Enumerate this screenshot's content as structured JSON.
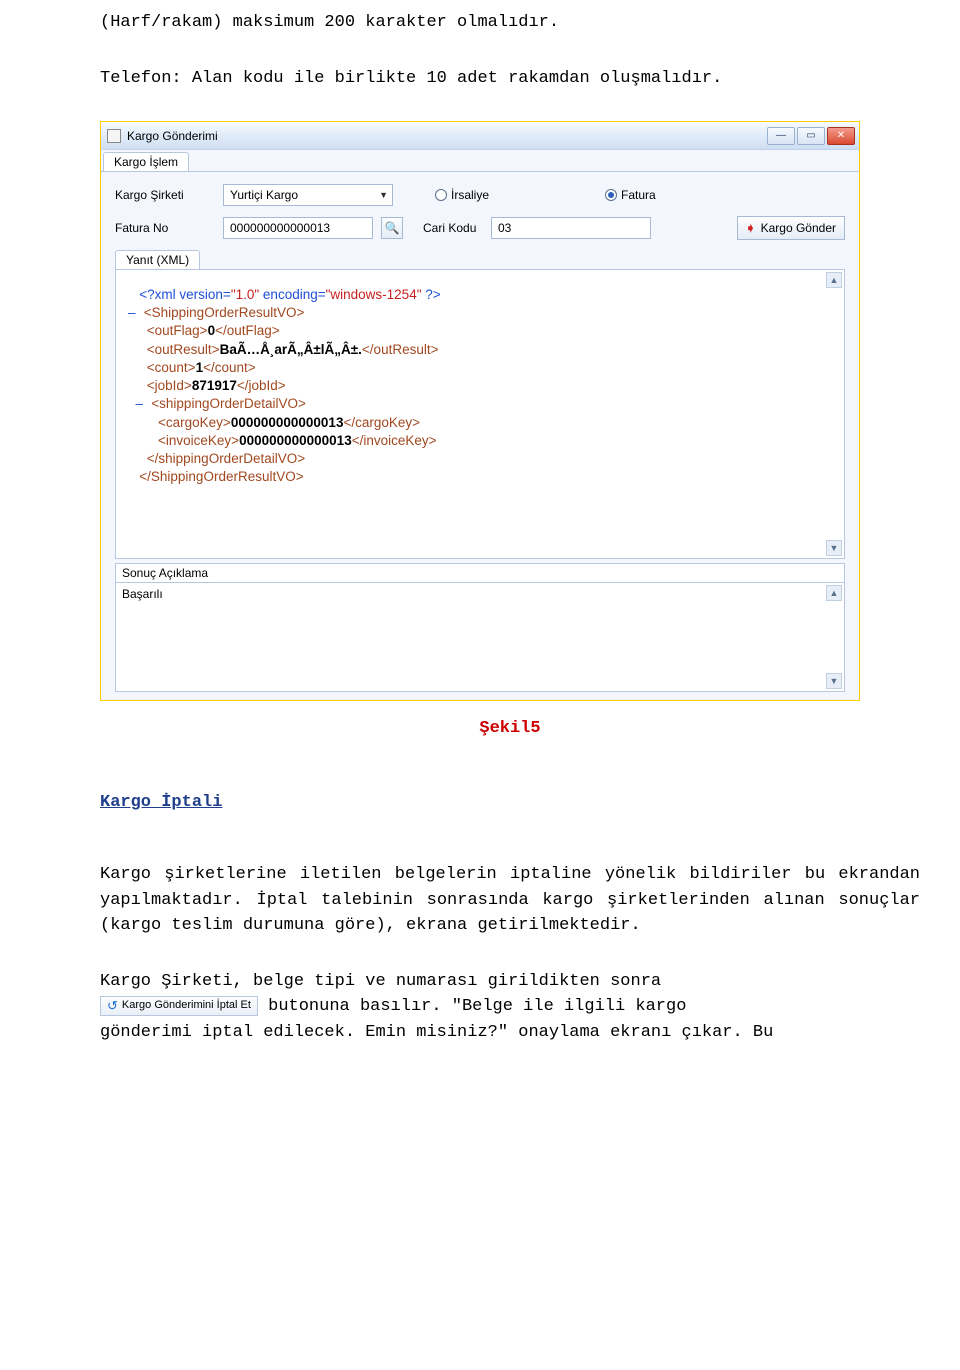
{
  "doc": {
    "note1": "(Harf/rakam) maksimum 200 karakter olmalıdır.",
    "note2": "Telefon: Alan kodu ile birlikte 10 adet rakamdan oluşmalıdır.",
    "caption": "Şekil5",
    "section_title": "Kargo İptali",
    "para1": "Kargo şirketlerine iletilen belgelerin iptaline yönelik bildiriler bu ekrandan yapılmaktadır. İptal talebinin sonrasında kargo şirketlerinden alınan sonuçlar (kargo teslim durumuna göre), ekrana getirilmektedir.",
    "para2_line1": "Kargo Şirketi, belge tipi ve numarası girildikten sonra",
    "inline_btn": "Kargo Gönderimini İptal Et",
    "para2_line2_a": " butonuna basılır. \"Belge ile ilgili kargo",
    "para2_line3": "gönderimi iptal edilecek. Emin misiniz?\" onaylama ekranı çıkar. Bu"
  },
  "win": {
    "title": "Kargo Gönderimi",
    "tab_main": "Kargo İşlem",
    "labels": {
      "company": "Kargo Şirketi",
      "invoice_no": "Fatura No",
      "cari_kodu": "Cari Kodu"
    },
    "company_select": "Yurtiçi Kargo",
    "radio_irsaliye": "İrsaliye",
    "radio_fatura": "Fatura",
    "invoice_no_value": "000000000000013",
    "cari_kodu_value": "03",
    "submit": "Kargo Gönder",
    "inner_tab": "Yanıt (XML)",
    "sonuc_label": "Sonuç Açıklama",
    "sonuc_value": "Başarılı"
  },
  "xml": {
    "decl_a": "<?xml version=",
    "decl_ver": "\"1.0\"",
    "decl_b": " encoding=",
    "decl_enc": "\"windows-1254\"",
    "decl_c": " ?>",
    "root_open": "<ShippingOrderResultVO>",
    "outflag_o": "<outFlag>",
    "outflag_v": "0",
    "outflag_c": "</outFlag>",
    "outres_o": "<outResult>",
    "outres_v": "BaÃ…Å¸arÃ„Â±lÃ„Â±.",
    "outres_c": "</outResult>",
    "count_o": "<count>",
    "count_v": "1",
    "count_c": "</count>",
    "jobid_o": "<jobId>",
    "jobid_v": "871917",
    "jobid_c": "</jobId>",
    "detail_open": "<shippingOrderDetailVO>",
    "cargo_o": "<cargoKey>",
    "cargo_v": "000000000000013",
    "cargo_c": "</cargoKey>",
    "inv_o": "<invoiceKey>",
    "inv_v": "000000000000013",
    "inv_c": "</invoiceKey>",
    "detail_close": "</shippingOrderDetailVO>",
    "root_close": "</ShippingOrderResultVO>"
  }
}
